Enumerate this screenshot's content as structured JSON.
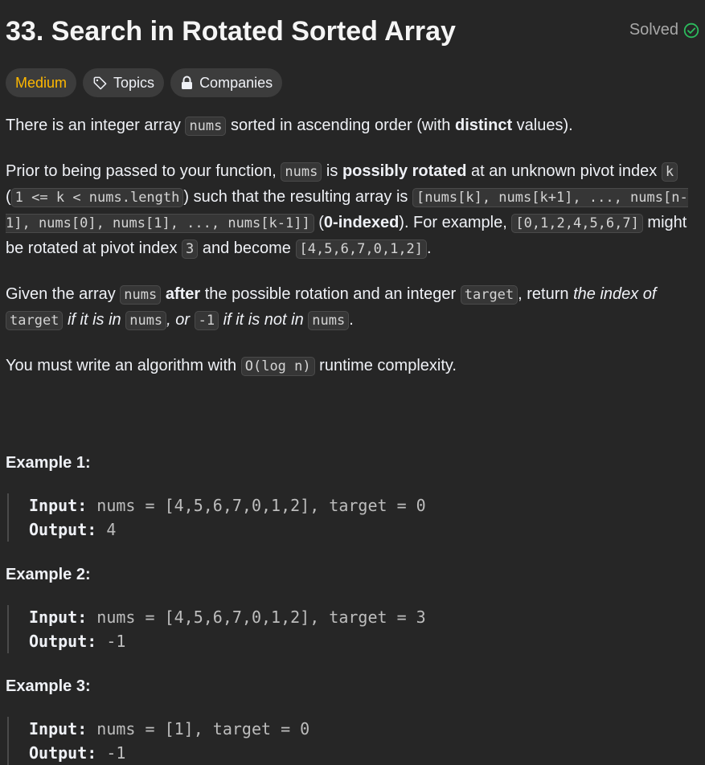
{
  "problem": {
    "title": "33. Search in Rotated Sorted Array",
    "status": "Solved",
    "difficulty": "Medium",
    "topics_label": "Topics",
    "companies_label": "Companies"
  },
  "colors": {
    "difficulty": "#ffb800",
    "solved_check": "#2cbb5d",
    "background": "#262626"
  },
  "icons": {
    "solved": "check-circle-icon",
    "topics": "tag-icon",
    "companies": "lock-icon"
  },
  "description": {
    "p1": {
      "t1": "There is an integer array ",
      "c1": "nums",
      "t2": " sorted in ascending order (with ",
      "b1": "distinct",
      "t3": " values)."
    },
    "p2": {
      "t1": "Prior to being passed to your function, ",
      "c1": "nums",
      "t2": " is ",
      "b1": "possibly rotated",
      "t3": " at an unknown pivot index ",
      "c2": "k",
      "t4": " (",
      "c3": "1 <= k < nums.length",
      "t5": ") such that the resulting array is ",
      "c4": "[nums[k], nums[k+1], ..., nums[n-1], nums[0], nums[1], ..., nums[k-1]]",
      "t6": " (",
      "b2": "0-indexed",
      "t7": "). For example, ",
      "c5": "[0,1,2,4,5,6,7]",
      "t8": " might be rotated at pivot index ",
      "c6": "3",
      "t9": " and become ",
      "c7": "[4,5,6,7,0,1,2]",
      "t10": "."
    },
    "p3": {
      "t1": "Given the array ",
      "c1": "nums",
      "t2": " ",
      "b1": "after",
      "t3": " the possible rotation and an integer ",
      "c2": "target",
      "t4": ", return ",
      "i1": "the index of ",
      "c3": "target",
      "i2": " if it is in ",
      "c4": "nums",
      "i3": ", or ",
      "c5": "-1",
      "i4": " if it is not in ",
      "c6": "nums",
      "t5": "."
    },
    "p4": {
      "t1": "You must write an algorithm with ",
      "c1": "O(log n)",
      "t2": " runtime complexity."
    }
  },
  "examples": [
    {
      "title": "Example 1:",
      "input_label": "Input:",
      "input": "nums = [4,5,6,7,0,1,2], target = 0",
      "output_label": "Output:",
      "output": "4"
    },
    {
      "title": "Example 2:",
      "input_label": "Input:",
      "input": "nums = [4,5,6,7,0,1,2], target = 3",
      "output_label": "Output:",
      "output": "-1"
    },
    {
      "title": "Example 3:",
      "input_label": "Input:",
      "input": "nums = [1], target = 0",
      "output_label": "Output:",
      "output": "-1"
    }
  ]
}
